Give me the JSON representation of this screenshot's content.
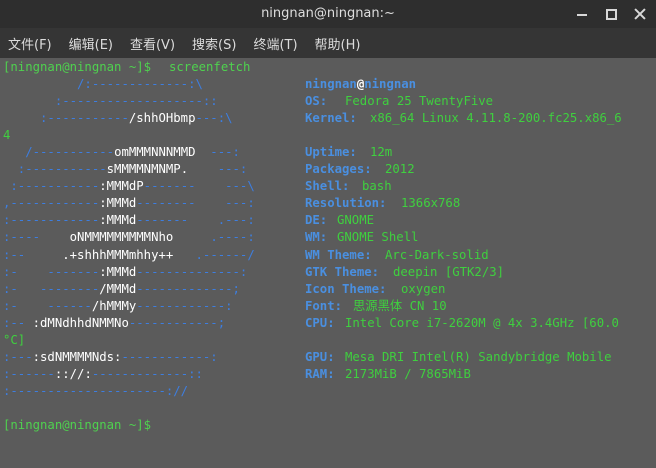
{
  "window": {
    "title": "ningnan@ningnan:~"
  },
  "menubar": {
    "items": [
      "文件(F)",
      "编辑(E)",
      "查看(V)",
      "搜索(S)",
      "终端(T)",
      "帮助(H)"
    ]
  },
  "terminal": {
    "prompt1": "[ningnan@ningnan ~]$",
    "command": "screenfetch",
    "prompt2": "[ningnan@ningnan ~]$",
    "logo": [
      "          /:-------------:\\",
      "       :-------------------::",
      "     :-----------/shhOHbmp---:\\",
      "",
      "   /-----------omMMMNNNMMD  ---:",
      "  :-----------sMMMMNMNMP.    ---:",
      " :-----------:MMMdP-------    ---\\",
      ",------------:MMMd--------    ---:",
      ":------------:MMMd-------    .---:",
      ":----    oNMMMMMMMMMNho     .----:",
      ":--     .+shhhMMMmhhy++   .------/",
      ":-    -------:MMMd--------------:",
      ":-   --------/MMMd-------------;",
      ":-    ------/hMMMy------------:",
      ":-- :dMNdhhdNMMNo------------;",
      "",
      ":---:sdNMMMMNds:------------:",
      ":------:://:-------------::",
      ":---------------------://"
    ],
    "user": "ningnan",
    "host": "ningnan",
    "info": [
      {
        "label": "OS:",
        "value": "Fedora 25 TwentyFive"
      },
      {
        "label": "Kernel:",
        "value": "x86_64 Linux 4.11.8-200.fc25.x86_6"
      },
      {
        "label": "",
        "value": ""
      },
      {
        "label": "Uptime:",
        "value": "12m"
      },
      {
        "label": "Packages:",
        "value": "2012"
      },
      {
        "label": "Shell:",
        "value": "bash"
      },
      {
        "label": "Resolution:",
        "value": "1366x768"
      },
      {
        "label": "DE:",
        "value": "GNOME"
      },
      {
        "label": "WM:",
        "value": "GNOME Shell"
      },
      {
        "label": "WM Theme:",
        "value": "Arc-Dark-solid"
      },
      {
        "label": "GTK Theme:",
        "value": "deepin [GTK2/3]"
      },
      {
        "label": "Icon Theme:",
        "value": "oxygen"
      },
      {
        "label": "Font:",
        "value": "思源黑体 CN 10"
      },
      {
        "label": "CPU:",
        "value": "Intel Core i7-2620M @ 4x 3.4GHz [60.0"
      },
      {
        "label": "",
        "value": ""
      },
      {
        "label": "GPU:",
        "value": "Mesa DRI Intel(R) Sandybridge Mobile"
      },
      {
        "label": "RAM:",
        "value": "2173MiB / 7865MiB"
      }
    ],
    "kernel_wrap": "4",
    "cpu_wrap": "°C]"
  },
  "colors": {
    "prompt": "#4fd14f",
    "label": "#4a8fe0",
    "logo_blue": "#3d7ee0",
    "background": "#5b5b5b"
  }
}
